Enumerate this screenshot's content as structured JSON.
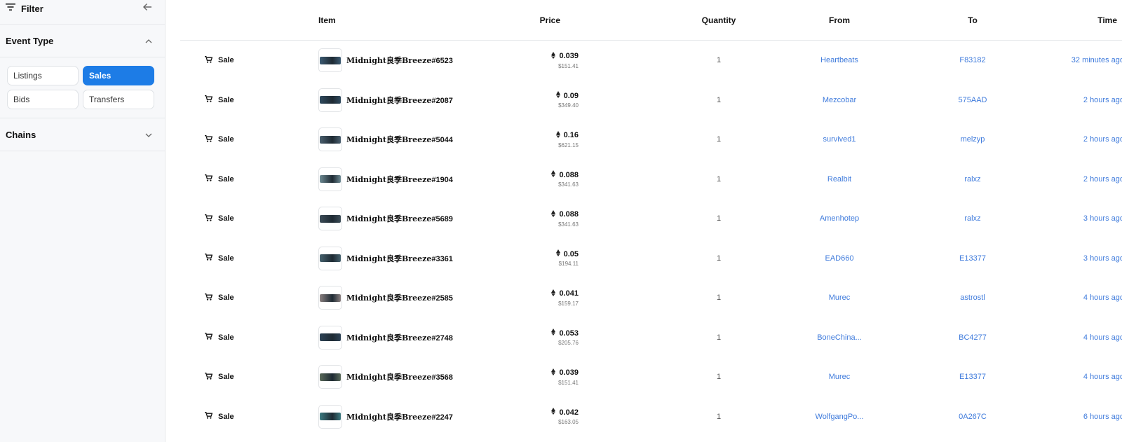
{
  "sidebar": {
    "filter_title": "Filter",
    "event_type": {
      "title": "Event Type",
      "chips": [
        "Listings",
        "Sales",
        "Bids",
        "Transfers"
      ],
      "active": "Sales"
    },
    "chains_title": "Chains"
  },
  "table": {
    "headers": {
      "item": "Item",
      "price": "Price",
      "quantity": "Quantity",
      "from": "From",
      "to": "To",
      "time": "Time"
    },
    "rows": [
      {
        "event": "Sale",
        "item_name": "Midnight良季Breeze",
        "item_number": "#6523",
        "eth": "0.039",
        "usd": "$151.41",
        "qty": "1",
        "from": "Heartbeats",
        "to": "F83182",
        "time": "32 minutes ago",
        "thumb_color": "#3b5a72"
      },
      {
        "event": "Sale",
        "item_name": "Midnight良季Breeze",
        "item_number": "#2087",
        "eth": "0.09",
        "usd": "$349.40",
        "qty": "1",
        "from": "Mezcobar",
        "to": "575AAD",
        "time": "2 hours ago",
        "thumb_color": "#2f4a5e"
      },
      {
        "event": "Sale",
        "item_name": "Midnight良季Breeze",
        "item_number": "#5044",
        "eth": "0.16",
        "usd": "$621.15",
        "qty": "1",
        "from": "survived1",
        "to": "melzyp",
        "time": "2 hours ago",
        "thumb_color": "#4a5f6e"
      },
      {
        "event": "Sale",
        "item_name": "Midnight良季Breeze",
        "item_number": "#1904",
        "eth": "0.088",
        "usd": "$341.63",
        "qty": "1",
        "from": "Realbit",
        "to": "ralxz",
        "time": "2 hours ago",
        "thumb_color": "#6d8a93"
      },
      {
        "event": "Sale",
        "item_name": "Midnight良季Breeze",
        "item_number": "#5689",
        "eth": "0.088",
        "usd": "$341.63",
        "qty": "1",
        "from": "Amenhotep",
        "to": "ralxz",
        "time": "3 hours ago",
        "thumb_color": "#3d4d58"
      },
      {
        "event": "Sale",
        "item_name": "Midnight良季Breeze",
        "item_number": "#3361",
        "eth": "0.05",
        "usd": "$194.11",
        "qty": "1",
        "from": "EAD660",
        "to": "E13377",
        "time": "3 hours ago",
        "thumb_color": "#46626e"
      },
      {
        "event": "Sale",
        "item_name": "Midnight良季Breeze",
        "item_number": "#2585",
        "eth": "0.041",
        "usd": "$159.17",
        "qty": "1",
        "from": "Murec",
        "to": "astrostl",
        "time": "4 hours ago",
        "thumb_color": "#8a8080"
      },
      {
        "event": "Sale",
        "item_name": "Midnight良季Breeze",
        "item_number": "#2748",
        "eth": "0.053",
        "usd": "$205.76",
        "qty": "1",
        "from": "BoneChina...",
        "to": "BC4277",
        "time": "4 hours ago",
        "thumb_color": "#2d4255"
      },
      {
        "event": "Sale",
        "item_name": "Midnight良季Breeze",
        "item_number": "#3568",
        "eth": "0.039",
        "usd": "$151.41",
        "qty": "1",
        "from": "Murec",
        "to": "E13377",
        "time": "4 hours ago",
        "thumb_color": "#5a6a5a"
      },
      {
        "event": "Sale",
        "item_name": "Midnight良季Breeze",
        "item_number": "#2247",
        "eth": "0.042",
        "usd": "$163.05",
        "qty": "1",
        "from": "WolfgangPo...",
        "to": "0A267C",
        "time": "6 hours ago",
        "thumb_color": "#3c7a80"
      }
    ]
  }
}
